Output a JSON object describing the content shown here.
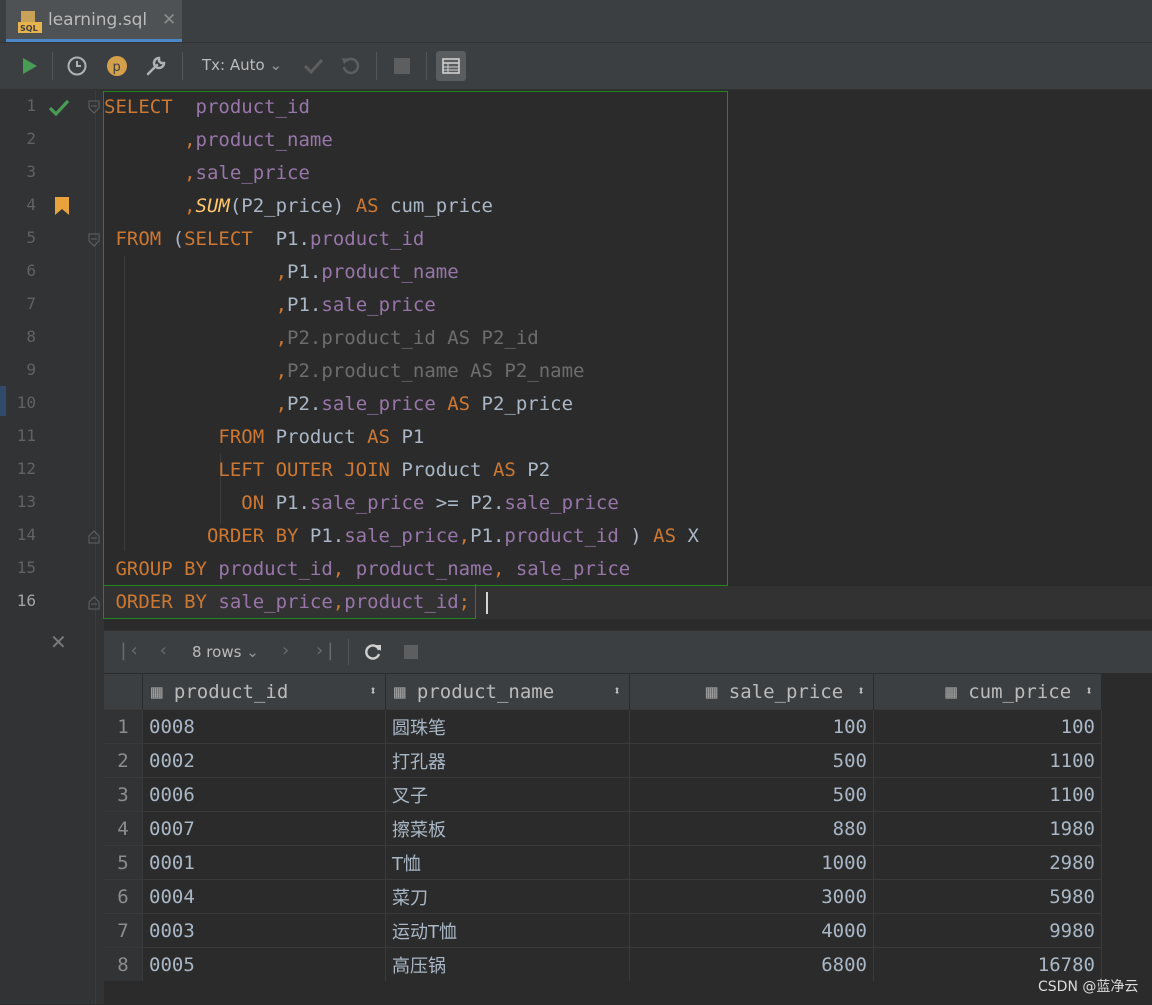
{
  "tab": {
    "title": "learning.sql",
    "close": "✕",
    "icon_label": "SQL"
  },
  "toolbar": {
    "tx_mode": "Tx: Auto"
  },
  "editor": {
    "line_numbers": [
      "1",
      "2",
      "3",
      "4",
      "5",
      "6",
      "7",
      "8",
      "9",
      "10",
      "11",
      "12",
      "13",
      "14",
      "15",
      "16"
    ],
    "lines": [
      [
        {
          "t": "SELECT",
          "c": "kw"
        },
        {
          "t": "  ",
          "c": "pl"
        },
        {
          "t": "product_id",
          "c": "col"
        }
      ],
      [
        {
          "t": "       ",
          "c": "pl"
        },
        {
          "t": ",",
          "c": "kw"
        },
        {
          "t": "product_name",
          "c": "col"
        }
      ],
      [
        {
          "t": "       ",
          "c": "pl"
        },
        {
          "t": ",",
          "c": "kw"
        },
        {
          "t": "sale_price",
          "c": "col"
        }
      ],
      [
        {
          "t": "       ",
          "c": "pl"
        },
        {
          "t": ",",
          "c": "kw"
        },
        {
          "t": "SUM",
          "c": "fn"
        },
        {
          "t": "(P2_price) ",
          "c": "pl"
        },
        {
          "t": "AS",
          "c": "kw"
        },
        {
          "t": " cum_price",
          "c": "pl"
        }
      ],
      [
        {
          "t": " FROM",
          "c": "kw"
        },
        {
          "t": " (",
          "c": "pl"
        },
        {
          "t": "SELECT",
          "c": "kw"
        },
        {
          "t": "  P1.",
          "c": "pl"
        },
        {
          "t": "product_id",
          "c": "col"
        }
      ],
      [
        {
          "t": "               ",
          "c": "pl"
        },
        {
          "t": ",",
          "c": "kw"
        },
        {
          "t": "P1.",
          "c": "pl"
        },
        {
          "t": "product_name",
          "c": "col"
        }
      ],
      [
        {
          "t": "               ",
          "c": "pl"
        },
        {
          "t": ",",
          "c": "kw"
        },
        {
          "t": "P1.",
          "c": "pl"
        },
        {
          "t": "sale_price",
          "c": "col"
        }
      ],
      [
        {
          "t": "               ",
          "c": "pl"
        },
        {
          "t": ",",
          "c": "kw"
        },
        {
          "t": "P2.product_id AS P2_id",
          "c": "gray"
        }
      ],
      [
        {
          "t": "               ",
          "c": "pl"
        },
        {
          "t": ",",
          "c": "kw"
        },
        {
          "t": "P2.product_name AS P2_name",
          "c": "gray"
        }
      ],
      [
        {
          "t": "               ",
          "c": "pl"
        },
        {
          "t": ",",
          "c": "kw"
        },
        {
          "t": "P2.",
          "c": "pl"
        },
        {
          "t": "sale_price",
          "c": "col"
        },
        {
          "t": " ",
          "c": "pl"
        },
        {
          "t": "AS",
          "c": "kw"
        },
        {
          "t": " P2_price",
          "c": "pl"
        }
      ],
      [
        {
          "t": "          ",
          "c": "pl"
        },
        {
          "t": "FROM",
          "c": "kw"
        },
        {
          "t": " Product ",
          "c": "pl"
        },
        {
          "t": "AS",
          "c": "kw"
        },
        {
          "t": " P1",
          "c": "pl"
        }
      ],
      [
        {
          "t": "          ",
          "c": "pl"
        },
        {
          "t": "LEFT OUTER JOIN",
          "c": "kw"
        },
        {
          "t": " Product ",
          "c": "pl"
        },
        {
          "t": "AS",
          "c": "kw"
        },
        {
          "t": " P2",
          "c": "pl"
        }
      ],
      [
        {
          "t": "            ",
          "c": "pl"
        },
        {
          "t": "ON",
          "c": "kw"
        },
        {
          "t": " P1.",
          "c": "pl"
        },
        {
          "t": "sale_price",
          "c": "col"
        },
        {
          "t": " >= P2.",
          "c": "pl"
        },
        {
          "t": "sale_price",
          "c": "col"
        }
      ],
      [
        {
          "t": "         ",
          "c": "pl"
        },
        {
          "t": "ORDER BY",
          "c": "kw"
        },
        {
          "t": " P1.",
          "c": "pl"
        },
        {
          "t": "sale_price",
          "c": "col"
        },
        {
          "t": ",",
          "c": "kw"
        },
        {
          "t": "P1.",
          "c": "pl"
        },
        {
          "t": "product_id",
          "c": "col"
        },
        {
          "t": " ) ",
          "c": "pl"
        },
        {
          "t": "AS",
          "c": "kw"
        },
        {
          "t": " X",
          "c": "pl"
        }
      ],
      [
        {
          "t": " GROUP BY",
          "c": "kw"
        },
        {
          "t": " ",
          "c": "pl"
        },
        {
          "t": "product_id",
          "c": "col"
        },
        {
          "t": ", ",
          "c": "kw"
        },
        {
          "t": "product_name",
          "c": "col"
        },
        {
          "t": ", ",
          "c": "kw"
        },
        {
          "t": "sale_price",
          "c": "col"
        }
      ],
      [
        {
          "t": " ORDER BY",
          "c": "kw"
        },
        {
          "t": " ",
          "c": "pl"
        },
        {
          "t": "sale_price",
          "c": "col"
        },
        {
          "t": ",",
          "c": "kw"
        },
        {
          "t": "product_id",
          "c": "col"
        },
        {
          "t": ";",
          "c": "kw"
        }
      ]
    ]
  },
  "results": {
    "row_count": "8 rows",
    "columns": [
      "product_id",
      "product_name",
      "sale_price",
      "cum_price"
    ],
    "rows": [
      [
        "1",
        "0008",
        "圆珠笔",
        "100",
        "100"
      ],
      [
        "2",
        "0002",
        "打孔器",
        "500",
        "1100"
      ],
      [
        "3",
        "0006",
        "叉子",
        "500",
        "1100"
      ],
      [
        "4",
        "0007",
        "擦菜板",
        "880",
        "1980"
      ],
      [
        "5",
        "0001",
        "T恤",
        "1000",
        "2980"
      ],
      [
        "6",
        "0004",
        "菜刀",
        "3000",
        "5980"
      ],
      [
        "7",
        "0003",
        "运动T恤",
        "4000",
        "9980"
      ],
      [
        "8",
        "0005",
        "高压锅",
        "6800",
        "16780"
      ]
    ]
  },
  "watermark": "CSDN @蓝净云",
  "colors": {
    "keyword": "#cc7832",
    "column": "#9876aa",
    "function": "#ffc66d",
    "run_green": "#499c54",
    "selection_border": "#1e8a1e"
  }
}
